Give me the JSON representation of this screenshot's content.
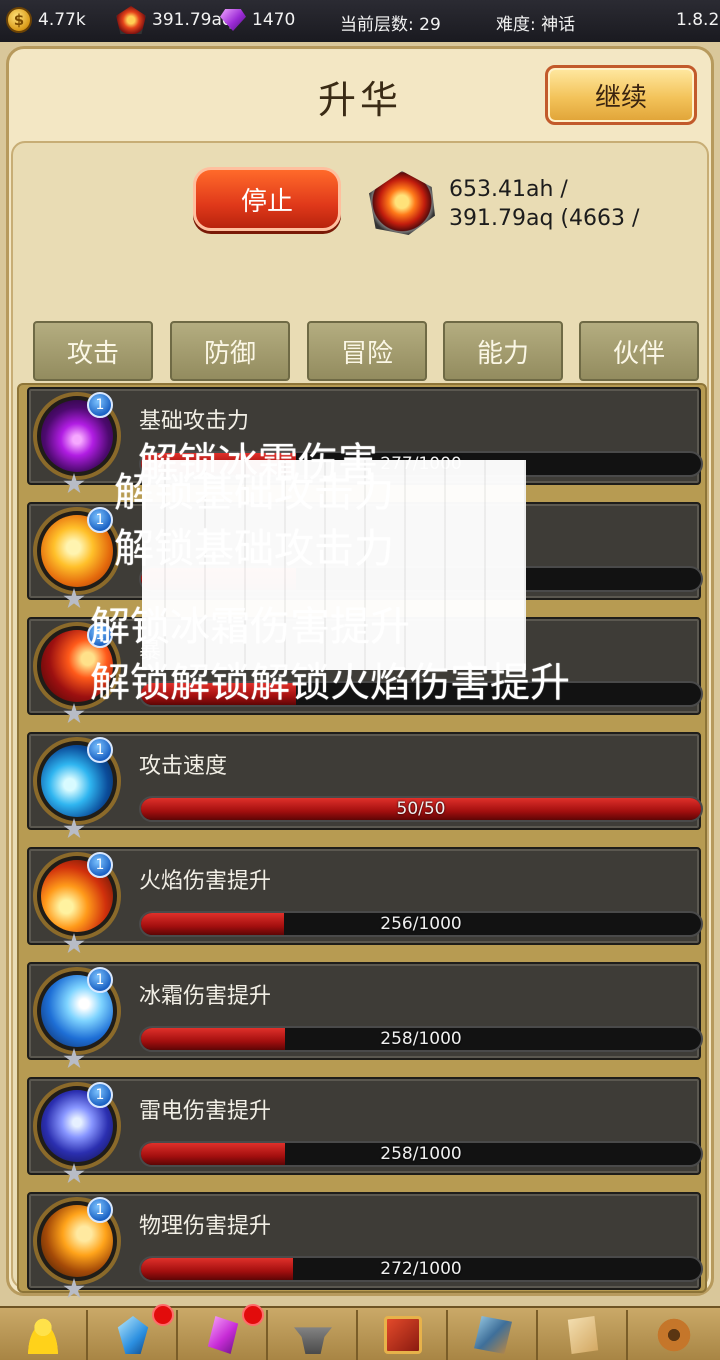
{
  "topbar": {
    "gold": "4.77k",
    "red_gem": "391.79aq",
    "purple_gem": "1470",
    "floor_label": "当前层数: 29",
    "difficulty_label": "难度: 神话",
    "version": "1.8.2"
  },
  "window": {
    "title": "升华",
    "continue_label": "继续",
    "stop_label": "停止",
    "cost_line1": "653.41ah /",
    "cost_line2": "391.79aq (4663 /"
  },
  "tabs": [
    "攻击",
    "防御",
    "冒险",
    "能力",
    "伙伴"
  ],
  "skills": [
    {
      "name": "基础攻击力",
      "level": "1",
      "progress": "277/1000",
      "fraction": 0.277,
      "icon": "purple-claw-icon"
    },
    {
      "name": "",
      "level": "1",
      "progress": "",
      "fraction": 0.277,
      "icon": "sun-swirl-icon"
    },
    {
      "name": "暴",
      "level": "1",
      "progress": "",
      "fraction": 0.277,
      "icon": "crit-slash-icon"
    },
    {
      "name": "攻击速度",
      "level": "1",
      "progress": "50/50",
      "fraction": 1.0,
      "icon": "wind-swirl-icon"
    },
    {
      "name": "火焰伤害提升",
      "level": "1",
      "progress": "256/1000",
      "fraction": 0.256,
      "icon": "fire-slash-icon"
    },
    {
      "name": "冰霜伤害提升",
      "level": "1",
      "progress": "258/1000",
      "fraction": 0.258,
      "icon": "frost-burst-icon"
    },
    {
      "name": "雷电伤害提升",
      "level": "1",
      "progress": "258/1000",
      "fraction": 0.258,
      "icon": "thunder-orb-icon"
    },
    {
      "name": "物理伤害提升",
      "level": "1",
      "progress": "272/1000",
      "fraction": 0.272,
      "icon": "meteor-icon"
    }
  ],
  "overlay": {
    "line1": "解锁冰霜伤害",
    "line2": "解锁基础攻击力",
    "line3": "解锁基础攻击力",
    "line4": "解锁冰霜伤害提升",
    "line5": "解锁解锁解锁火焰伤害提升"
  },
  "bottomnav": [
    "user-icon",
    "blue-crystal-icon",
    "purple-crystal-icon",
    "anvil-icon",
    "spellbook-icon",
    "map-icon",
    "scroll-icon",
    "gear-icon"
  ]
}
